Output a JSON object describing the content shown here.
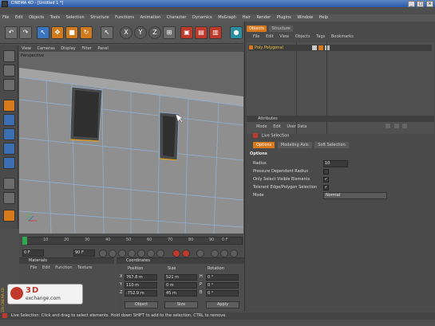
{
  "window": {
    "title": "CINEMA 4D - [Untitled 1 *]"
  },
  "menubar": [
    "File",
    "Edit",
    "Objects",
    "Tools",
    "Selection",
    "Structure",
    "Functions",
    "Animation",
    "Character",
    "Dynamics",
    "MoGraph",
    "Hair",
    "Render",
    "Plugins",
    "Window",
    "Help"
  ],
  "viewport": {
    "menu": [
      "View",
      "Cameras",
      "Display",
      "Filter",
      "Panel"
    ],
    "label": "Perspective"
  },
  "timeline": {
    "ticks": [
      "0",
      "10",
      "20",
      "30",
      "40",
      "50",
      "60",
      "70",
      "80",
      "90"
    ],
    "end_field": "0 F"
  },
  "playback": {
    "current_frame": "0 F",
    "end_frame": "90 F"
  },
  "material_panel": {
    "title": "Materials",
    "menu": [
      "File",
      "Edit",
      "Function",
      "Texture"
    ]
  },
  "logo": {
    "text": "3D",
    "subtext": "exchange.com",
    "side_text": "MAXON CINEMA 4D"
  },
  "coordinates_panel": {
    "title": "Coordinates",
    "columns": [
      "Position",
      "Size",
      "Rotation"
    ],
    "rows": [
      {
        "axis": "X",
        "position": "767.8 m",
        "size": "521 m",
        "rot_axis": "H",
        "rotation": "0 °"
      },
      {
        "axis": "Y",
        "position": "110 m",
        "size": "0 m",
        "rot_axis": "P",
        "rotation": "0 °"
      },
      {
        "axis": "Z",
        "position": "-752.9 m",
        "size": "45 m",
        "rot_axis": "B",
        "rotation": "0 °"
      }
    ],
    "mode_select": "Object",
    "size_select": "Size",
    "apply_label": "Apply"
  },
  "objects_panel": {
    "tabs": [
      "Objects",
      "Structure"
    ],
    "menu": [
      "File",
      "Edit",
      "View",
      "Objects",
      "Tags",
      "Bookmarks"
    ],
    "object_name": "Poly Polygonal"
  },
  "attributes_panel": {
    "title": "Attributes",
    "menu": [
      "Mode",
      "Edit",
      "User Data"
    ],
    "tool_name": "Live Selection",
    "tabs": [
      "Options",
      "Modeling Axis",
      "Soft Selection"
    ],
    "section": "Options",
    "fields": [
      {
        "label": "Radius",
        "value": "10"
      },
      {
        "label": "Pressure Dependent Radius",
        "value": ""
      },
      {
        "label": "Only Select Visible Elements",
        "value": "✓"
      },
      {
        "label": "Tolerant Edge/Polygon Selection",
        "value": "✓"
      },
      {
        "label": "Mode",
        "value": "Normal"
      }
    ]
  },
  "status": {
    "text": "Live Selection: Click and drag to select elements. Hold down SHIFT to add to the selection, CTRL to remove."
  },
  "colors": {
    "accent": "#d9771b",
    "title_blue": "#2c5aa8",
    "panel": "#4a4a4a",
    "object_yellow": "#f0c040"
  }
}
